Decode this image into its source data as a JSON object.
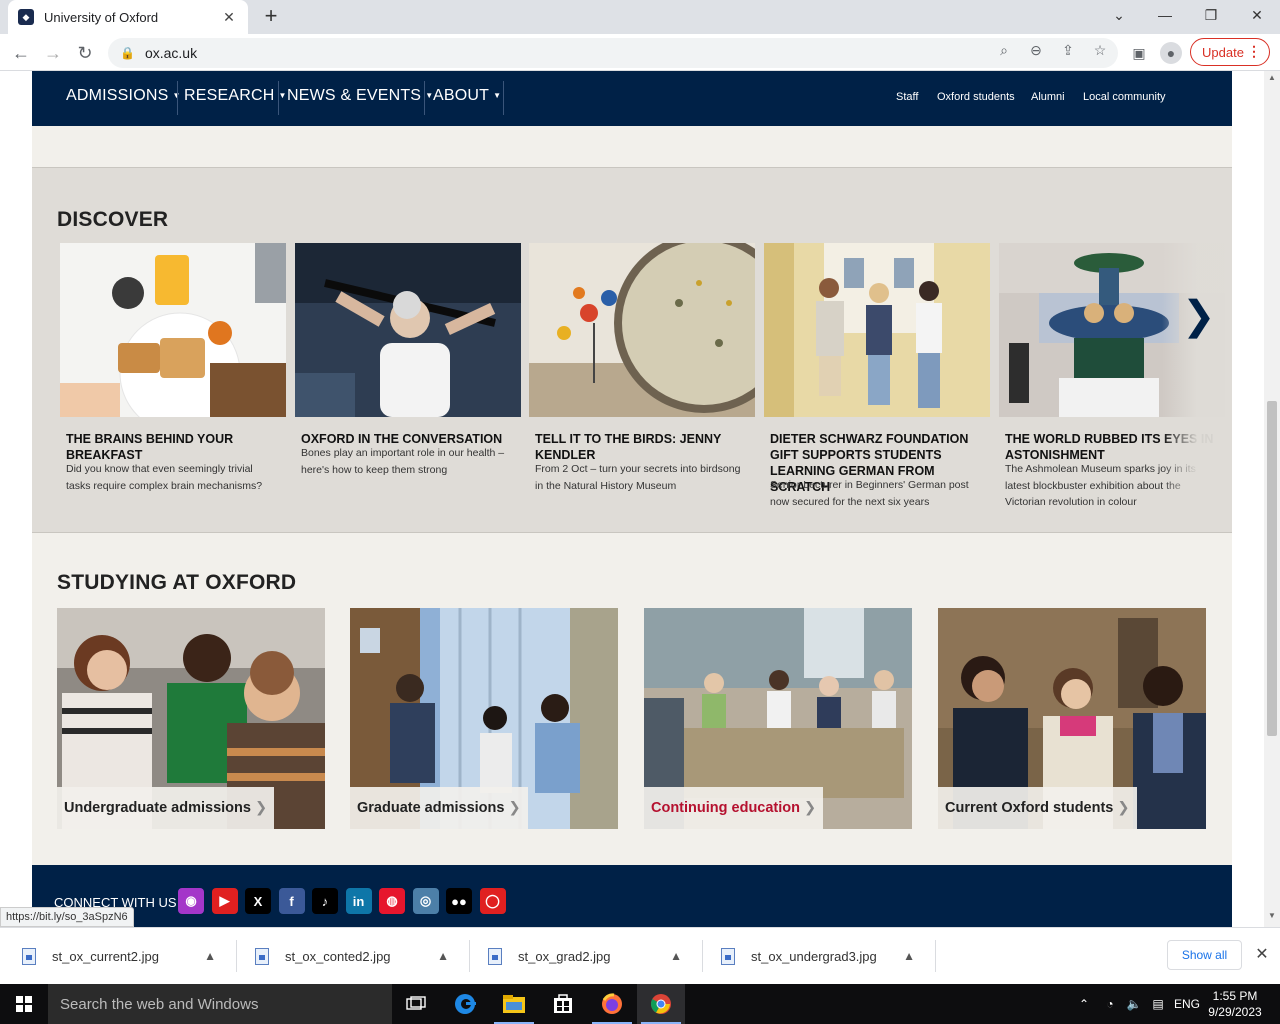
{
  "browser": {
    "tab_title": "University of Oxford",
    "new_tab_symbol": "+",
    "url": "ox.ac.uk",
    "update_label": "Update",
    "window_controls": [
      "chevron-down",
      "minimize",
      "restore",
      "close"
    ]
  },
  "site": {
    "nav": {
      "items": [
        "ADMISSIONS",
        "RESEARCH",
        "NEWS & EVENTS",
        "ABOUT"
      ],
      "quick_links": [
        "Staff",
        "Oxford students",
        "Alumni",
        "Local community"
      ]
    },
    "discover": {
      "title": "DISCOVER",
      "cards": [
        {
          "title": "THE BRAINS BEHIND YOUR BREAKFAST",
          "description": "Did you know that even seemingly trivial tasks require complex brain mechanisms?"
        },
        {
          "title": "OXFORD IN THE CONVERSATION",
          "description": "Bones play an important role in our health – here's how to keep them strong"
        },
        {
          "title": "TELL IT TO THE BIRDS: JENNY KENDLER",
          "description": "From 2 Oct – turn your secrets into birdsong in the Natural History Museum"
        },
        {
          "title": "DIETER SCHWARZ FOUNDATION GIFT SUPPORTS STUDENTS LEARNING GERMAN FROM SCRATCH",
          "description": "Senior Lecturer in Beginners' German post now secured for the next six years"
        },
        {
          "title": "THE WORLD RUBBED ITS EYES IN ASTONISHMENT",
          "description": "The Ashmolean Museum sparks joy in its latest blockbuster exhibition about the Victorian revolution in colour"
        }
      ],
      "next_symbol": "❯"
    },
    "studying": {
      "title": "STUDYING AT OXFORD",
      "tiles": [
        {
          "label": "Undergraduate admissions",
          "color": "#222222"
        },
        {
          "label": "Graduate admissions",
          "color": "#222222"
        },
        {
          "label": "Continuing education",
          "color": "#b5112f"
        },
        {
          "label": "Current Oxford students",
          "color": "#222222"
        }
      ],
      "chevron": "❯"
    },
    "footer": {
      "connect_label": "CONNECT WITH US",
      "social": [
        {
          "icon": "podcast-icon",
          "glyph": "◉",
          "color": "#a436c9"
        },
        {
          "icon": "youtube-icon",
          "glyph": "▶",
          "color": "#e02020"
        },
        {
          "icon": "x-icon",
          "glyph": "X",
          "color": "#000000"
        },
        {
          "icon": "facebook-icon",
          "glyph": "f",
          "color": "#3b5998"
        },
        {
          "icon": "tiktok-icon",
          "glyph": "♪",
          "color": "#000000"
        },
        {
          "icon": "linkedin-icon",
          "glyph": "in",
          "color": "#0e76a8"
        },
        {
          "icon": "weibo-icon",
          "glyph": "◍",
          "color": "#e6162d"
        },
        {
          "icon": "instagram-icon",
          "glyph": "◎",
          "color": "#4c7fa8"
        },
        {
          "icon": "medium-icon",
          "glyph": "●●",
          "color": "#000000"
        },
        {
          "icon": "chat-icon",
          "glyph": "◯",
          "color": "#e02020"
        }
      ]
    },
    "status_url": "https://bit.ly/so_3aSpzN6"
  },
  "downloads": {
    "items": [
      "st_ox_current2.jpg",
      "st_ox_conted2.jpg",
      "st_ox_grad2.jpg",
      "st_ox_undergrad3.jpg"
    ],
    "show_all_label": "Show all"
  },
  "taskbar": {
    "search_placeholder": "Search the web and Windows",
    "language": "ENG",
    "time": "1:55 PM",
    "date": "9/29/2023"
  },
  "colors": {
    "oxford_blue": "#002147",
    "page_bg": "#f2f0eb",
    "discover_bg": "#dfdcd7",
    "update_red": "#d93025",
    "link_red": "#b5112f"
  }
}
